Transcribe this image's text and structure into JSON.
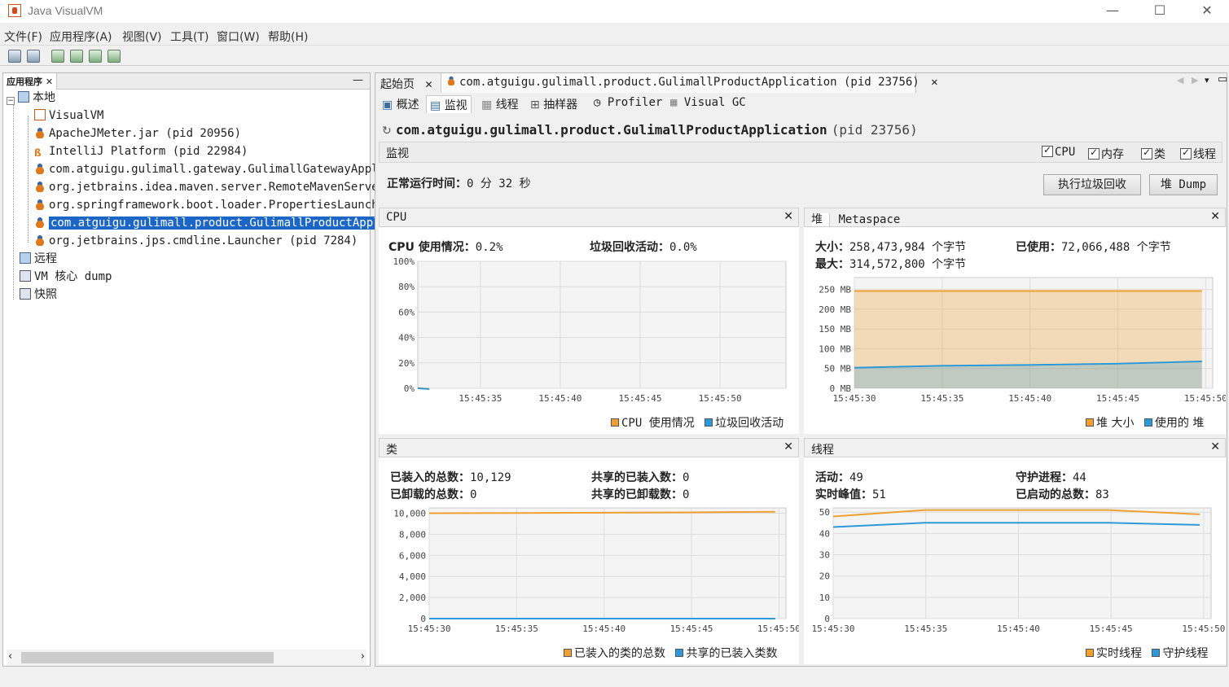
{
  "window": {
    "title": "Java VisualVM",
    "minimize": "—",
    "maximize": "☐",
    "close": "✕"
  },
  "menu": [
    "文件(F)",
    "应用程序(A)",
    "视图(V)",
    "工具(T)",
    "窗口(W)",
    "帮助(H)"
  ],
  "left_panel": {
    "tab": "应用程序",
    "tab_close": "✕",
    "minimize": "—",
    "tree": [
      {
        "label": "本地",
        "icon": "computer-icon"
      },
      {
        "label": "VisualVM",
        "icon": "visualvm-icon"
      },
      {
        "label": "ApacheJMeter.jar (pid 20956)",
        "icon": "java-icon"
      },
      {
        "label": "IntelliJ Platform (pid 22984)",
        "icon": "intellij-icon"
      },
      {
        "label": "com.atguigu.gulimall.gateway.GulimallGatewayAppli",
        "icon": "java-icon"
      },
      {
        "label": "org.jetbrains.idea.maven.server.RemoteMavenServer",
        "icon": "java-icon"
      },
      {
        "label": "org.springframework.boot.loader.PropertiesLaunche",
        "icon": "java-icon"
      },
      {
        "label": "com.atguigu.gulimall.product.GulimallProductAppli",
        "icon": "java-icon",
        "selected": true
      },
      {
        "label": "org.jetbrains.jps.cmdline.Launcher (pid 7284)",
        "icon": "java-icon"
      },
      {
        "label": "远程",
        "icon": "remote-icon"
      },
      {
        "label": "VM 核心 dump",
        "icon": "coredump-icon"
      },
      {
        "label": "快照",
        "icon": "snapshot-icon"
      }
    ]
  },
  "doc_tabs": [
    {
      "label": "起始页",
      "close": "✕"
    },
    {
      "label": "com.atguigu.gulimall.product.GulimallProductApplication (pid 23756)",
      "close": "✕"
    }
  ],
  "sub_tabs": [
    "概述",
    "监视",
    "线程",
    "抽样器",
    "Profiler",
    "Visual GC"
  ],
  "app_title": {
    "name": "com.atguigu.gulimall.product.GulimallProductApplication",
    "pid": "(pid 23756)"
  },
  "monitor": {
    "label": "监视",
    "checks": [
      "CPU",
      "内存",
      "类",
      "线程"
    ],
    "uptime_label": "正常运行时间：",
    "uptime_value": "0 分 32 秒",
    "gc_button": "执行垃圾回收",
    "dump_button": "堆 Dump"
  },
  "cpu_panel": {
    "title": "CPU",
    "close": "✕",
    "usage_label": "CPU 使用情况：",
    "usage_value": "0.2%",
    "gc_label": "垃圾回收活动：",
    "gc_value": "0.0%",
    "legend": [
      "CPU 使用情况",
      "垃圾回收活动"
    ]
  },
  "heap_panel": {
    "tab1": "堆",
    "tab2": "Metaspace",
    "close": "✕",
    "size_label": "大小：",
    "size_value": "258,473,984 个字节",
    "max_label": "最大：",
    "max_value": "314,572,800 个字节",
    "used_label": "已使用：",
    "used_value": "72,066,488 个字节",
    "legend": [
      "堆 大小",
      "使用的 堆"
    ]
  },
  "class_panel": {
    "title": "类",
    "close": "✕",
    "loaded_label": "已装入的总数：",
    "loaded_value": "10,129",
    "unloaded_label": "已卸载的总数：",
    "unloaded_value": "0",
    "shared_loaded_label": "共享的已装入数：",
    "shared_loaded_value": "0",
    "shared_unloaded_label": "共享的已卸载数：",
    "shared_unloaded_value": "0",
    "legend": [
      "已装入的类的总数",
      "共享的已装入类数"
    ]
  },
  "thread_panel": {
    "title": "线程",
    "close": "✕",
    "live_label": "活动：",
    "live_value": "49",
    "peak_label": "实时峰值：",
    "peak_value": "51",
    "daemon_label": "守护进程：",
    "daemon_value": "44",
    "started_label": "已启动的总数：",
    "started_value": "83",
    "legend": [
      "实时线程",
      "守护线程"
    ]
  },
  "chart_data": [
    {
      "type": "line",
      "title": "CPU",
      "x": [
        "15:45:35",
        "15:45:40",
        "15:45:45",
        "15:45:50"
      ],
      "yticks": [
        "100%",
        "80%",
        "60%",
        "40%",
        "20%",
        "0%"
      ],
      "ylim": [
        0,
        100
      ],
      "series": [
        {
          "name": "CPU 使用情况",
          "color": "#f0a030",
          "values": [
            0.2
          ]
        },
        {
          "name": "垃圾回收活动",
          "color": "#2c9ad8",
          "values": [
            0.0
          ]
        }
      ]
    },
    {
      "type": "area",
      "title": "堆",
      "x": [
        "15:45:30",
        "15:45:35",
        "15:45:40",
        "15:45:45",
        "15:45:50"
      ],
      "yticks": [
        "250 MB",
        "200 MB",
        "150 MB",
        "100 MB",
        "50 MB",
        "0 MB"
      ],
      "ylim": [
        0,
        280
      ],
      "series": [
        {
          "name": "堆 大小",
          "color": "#f0a030",
          "values": [
            246,
            246,
            246,
            246,
            246
          ]
        },
        {
          "name": "使用的 堆",
          "color": "#2c9ad8",
          "values": [
            52,
            57,
            59,
            62,
            68
          ]
        }
      ]
    },
    {
      "type": "line",
      "title": "类",
      "x": [
        "15:45:30",
        "15:45:35",
        "15:45:40",
        "15:45:45",
        "15:45:50"
      ],
      "yticks": [
        "10,000",
        "8,000",
        "6,000",
        "4,000",
        "2,000",
        "0"
      ],
      "ylim": [
        0,
        10500
      ],
      "series": [
        {
          "name": "已装入的类的总数",
          "color": "#f0a030",
          "values": [
            10000,
            10020,
            10050,
            10080,
            10129
          ]
        },
        {
          "name": "共享的已装入类数",
          "color": "#2c9ad8",
          "values": [
            0,
            0,
            0,
            0,
            0
          ]
        }
      ]
    },
    {
      "type": "line",
      "title": "线程",
      "x": [
        "15:45:30",
        "15:45:35",
        "15:45:40",
        "15:45:45",
        "15:45:50"
      ],
      "yticks": [
        "50",
        "40",
        "30",
        "20",
        "10",
        "0"
      ],
      "ylim": [
        0,
        52
      ],
      "series": [
        {
          "name": "实时线程",
          "color": "#f0a030",
          "values": [
            48,
            51,
            51,
            51,
            49
          ]
        },
        {
          "name": "守护线程",
          "color": "#2c9ad8",
          "values": [
            43,
            45,
            45,
            45,
            44
          ]
        }
      ]
    }
  ]
}
